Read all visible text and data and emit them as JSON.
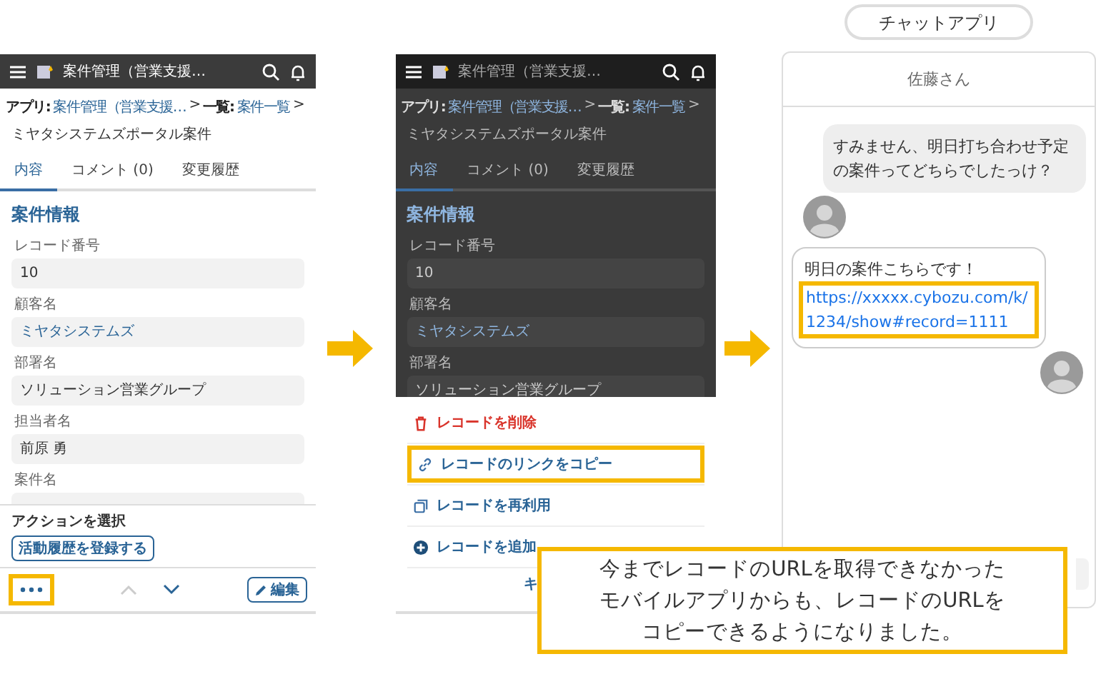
{
  "screens": [
    {
      "dimmed": false,
      "header": {
        "title": "案件管理（営業支援…"
      },
      "breadcrumb": [
        {
          "label": "アプリ:",
          "link": "案件管理（営業支援…",
          "sep": ">"
        },
        {
          "label": "一覧:",
          "link": "案件一覧",
          "sep": ">"
        }
      ],
      "record_title": "ミヤタシステムズポータル案件",
      "tabs": [
        {
          "label": "内容",
          "selected": true
        },
        {
          "label": "コメント (0)",
          "selected": false
        },
        {
          "label": "変更履歴",
          "selected": false
        }
      ],
      "section": "案件情報",
      "fields": [
        {
          "label": "レコード番号",
          "value": "10",
          "kind": "text"
        },
        {
          "label": "顧客名",
          "value": "ミヤタシステムズ",
          "kind": "link"
        },
        {
          "label": "部署名",
          "value": "ソリューション営業グループ",
          "kind": "text"
        },
        {
          "label": "担当者名",
          "value": "前原 勇",
          "kind": "text"
        },
        {
          "label": "案件名",
          "kind": "text"
        }
      ],
      "action_bar": {
        "label": "アクションを選択",
        "button": "活動履歴を登録する"
      },
      "bottom_bar": {
        "more_highlighted": true,
        "prev_disabled": true,
        "next_disabled": false,
        "edit": "編集"
      }
    },
    {
      "dimmed": true,
      "header": {
        "title": "案件管理（営業支援…"
      },
      "breadcrumb": [
        {
          "label": "アプリ:",
          "link": "案件管理（営業支援…",
          "sep": ">"
        },
        {
          "label": "一覧:",
          "link": "案件一覧",
          "sep": ">"
        }
      ],
      "record_title": "ミヤタシステムズポータル案件",
      "tabs": [
        {
          "label": "内容",
          "selected": true
        },
        {
          "label": "コメント (0)",
          "selected": false
        },
        {
          "label": "変更履歴",
          "selected": false
        }
      ],
      "section": "案件情報",
      "fields": [
        {
          "label": "レコード番号",
          "value": "10",
          "kind": "text"
        },
        {
          "label": "顧客名",
          "value": "ミヤタシステムズ",
          "kind": "link"
        },
        {
          "label": "部署名",
          "value": "ソリューション営業グループ",
          "kind": "text"
        }
      ],
      "sheet": {
        "items": [
          {
            "kind": "delete",
            "label": "レコードを削除",
            "highlighted": false
          },
          {
            "kind": "link",
            "label": "レコードのリンクをコピー",
            "highlighted": true
          },
          {
            "kind": "reuse",
            "label": "レコードを再利用",
            "highlighted": false
          },
          {
            "kind": "add",
            "label": "レコードを追加",
            "highlighted": false
          }
        ],
        "cancel": "キ"
      }
    }
  ],
  "chat": {
    "app_label": "チャットアプリ",
    "contact": "佐藤さん",
    "messages": [
      {
        "kind": "incoming",
        "text": "すみません、明日打ち合わせ予定の案件ってどちらでしたっけ？"
      },
      {
        "kind": "outgoing",
        "text": "明日の案件こちらです！",
        "link": "https://xxxxx.cybozu.com/k/1234/show#record=1111",
        "link_highlighted": true
      }
    ]
  },
  "callout": {
    "text": "今までレコードのURLを取得できなかったモバイルアプリからも、レコードのURLをコピーできるようになりました。"
  }
}
